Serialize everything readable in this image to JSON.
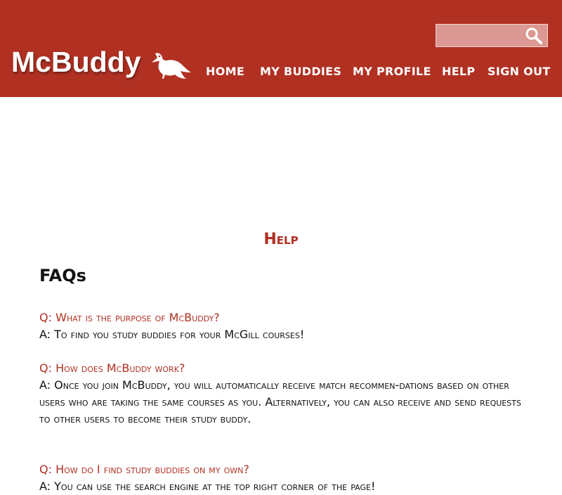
{
  "header": {
    "logo": "McBuddy",
    "logo_icon": "bird-icon",
    "search": {
      "placeholder": "",
      "value": "",
      "icon": "search-icon"
    },
    "nav": [
      {
        "label": "HOME"
      },
      {
        "label": "MY BUDDIES"
      },
      {
        "label": "MY PROFILE"
      },
      {
        "label": "HELP"
      },
      {
        "label": "SIGN OUT"
      }
    ],
    "colors": {
      "brand": "#b03022",
      "search_bg": "#dc9892"
    }
  },
  "main": {
    "title": "Help",
    "faq_heading": "FAQs",
    "faqs": [
      {
        "q": "Q: What is the purpose of McBuddy?",
        "a": "A: To find you study buddies for your McGill courses!"
      },
      {
        "q": "Q: How does McBuddy work?",
        "a": "A: Once you join McBuddy, you will automatically receive match recommen-dations based on other users who are taking the same courses as you. Alternatively, you can also receive and send requests to other users to become their study buddy."
      },
      {
        "q": "Q: How do I find study buddies on my own?",
        "a": "A: You can use the search engine at the top right corner of the page!"
      }
    ]
  }
}
